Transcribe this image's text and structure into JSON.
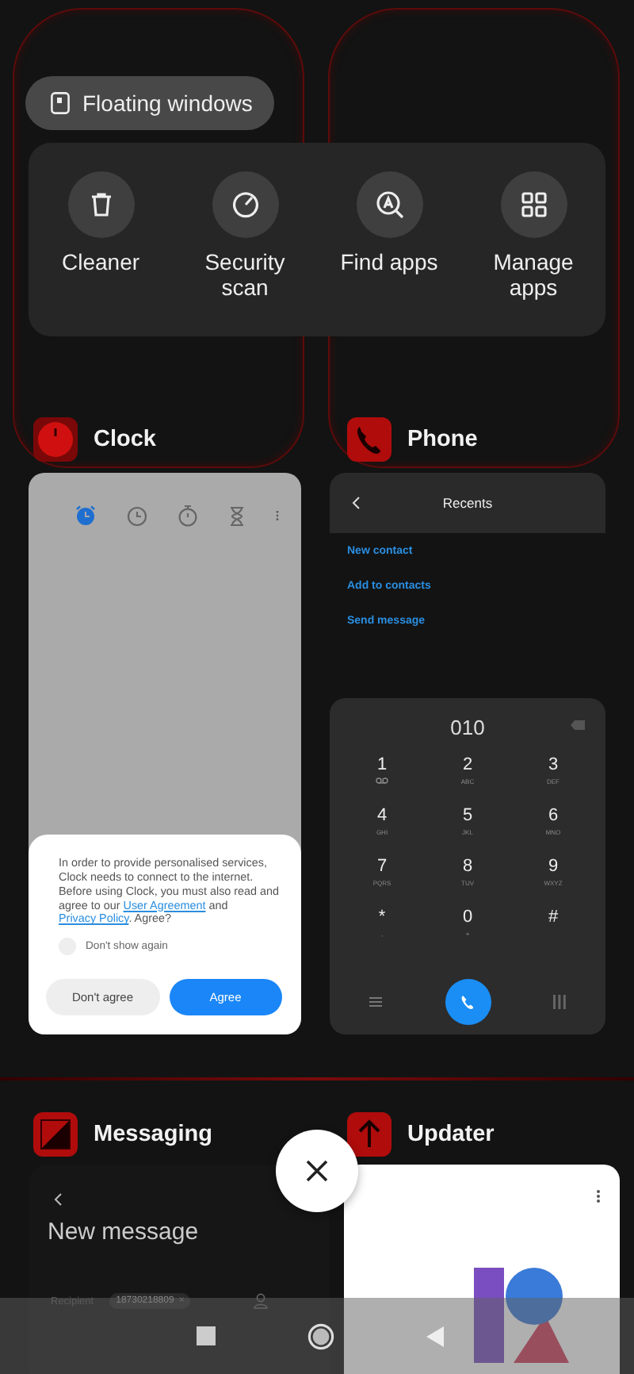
{
  "floating_button": {
    "label": "Floating windows"
  },
  "quick_actions": [
    {
      "label": "Cleaner",
      "kind": "trash"
    },
    {
      "label": "Security scan",
      "kind": "gauge"
    },
    {
      "label": "Find apps",
      "kind": "find"
    },
    {
      "label": "Manage apps",
      "kind": "grid"
    }
  ],
  "clock_card": {
    "app_name": "Clock",
    "tabs": [
      {
        "kind": "alarm",
        "selected": true
      },
      {
        "kind": "clock",
        "selected": false
      },
      {
        "kind": "stopwatch",
        "selected": false
      },
      {
        "kind": "timer",
        "selected": false
      }
    ],
    "dialog": {
      "message": [
        {
          "kind": "plain",
          "text": "In order to provide personalised services, Clock needs to connect to the internet. Before using Clock, you must also read and agree to our "
        },
        {
          "kind": "link",
          "text": "User Agreement"
        },
        {
          "kind": "plain",
          "text": " and "
        },
        {
          "kind": "link",
          "text": "Privacy Policy"
        },
        {
          "kind": "plain",
          "text": ". Agree?"
        }
      ],
      "checkbox": {
        "label": "Don't show again",
        "checked": false
      },
      "buttons": [
        {
          "label": "Don't agree",
          "kind": "secondary"
        },
        {
          "label": "Agree",
          "kind": "primary"
        }
      ]
    }
  },
  "phone_card": {
    "app_name": "Phone",
    "title": "Recents",
    "actions": [
      "New contact",
      "Add to contacts",
      "Send message"
    ],
    "number": "010",
    "keys": [
      {
        "digit": "1",
        "kind": "voicemail"
      },
      {
        "digit": "2",
        "letters": "ABC"
      },
      {
        "digit": "3",
        "letters": "DEF"
      },
      {
        "digit": "4",
        "letters": "GHI"
      },
      {
        "digit": "5",
        "letters": "JKL"
      },
      {
        "digit": "6",
        "letters": "MNO"
      },
      {
        "digit": "7",
        "letters": "PQRS"
      },
      {
        "digit": "8",
        "letters": "TUV"
      },
      {
        "digit": "9",
        "letters": "WXYZ"
      },
      {
        "digit": "*",
        "letters": ","
      },
      {
        "digit": "0",
        "letters": "+"
      },
      {
        "digit": "#"
      }
    ]
  },
  "messaging_card": {
    "app_name": "Messaging",
    "title": "New message",
    "recipient_label": "Recipient",
    "recipient_chip": "18730218809",
    "chip_remove": "×"
  },
  "updater_card": {
    "app_name": "Updater"
  }
}
